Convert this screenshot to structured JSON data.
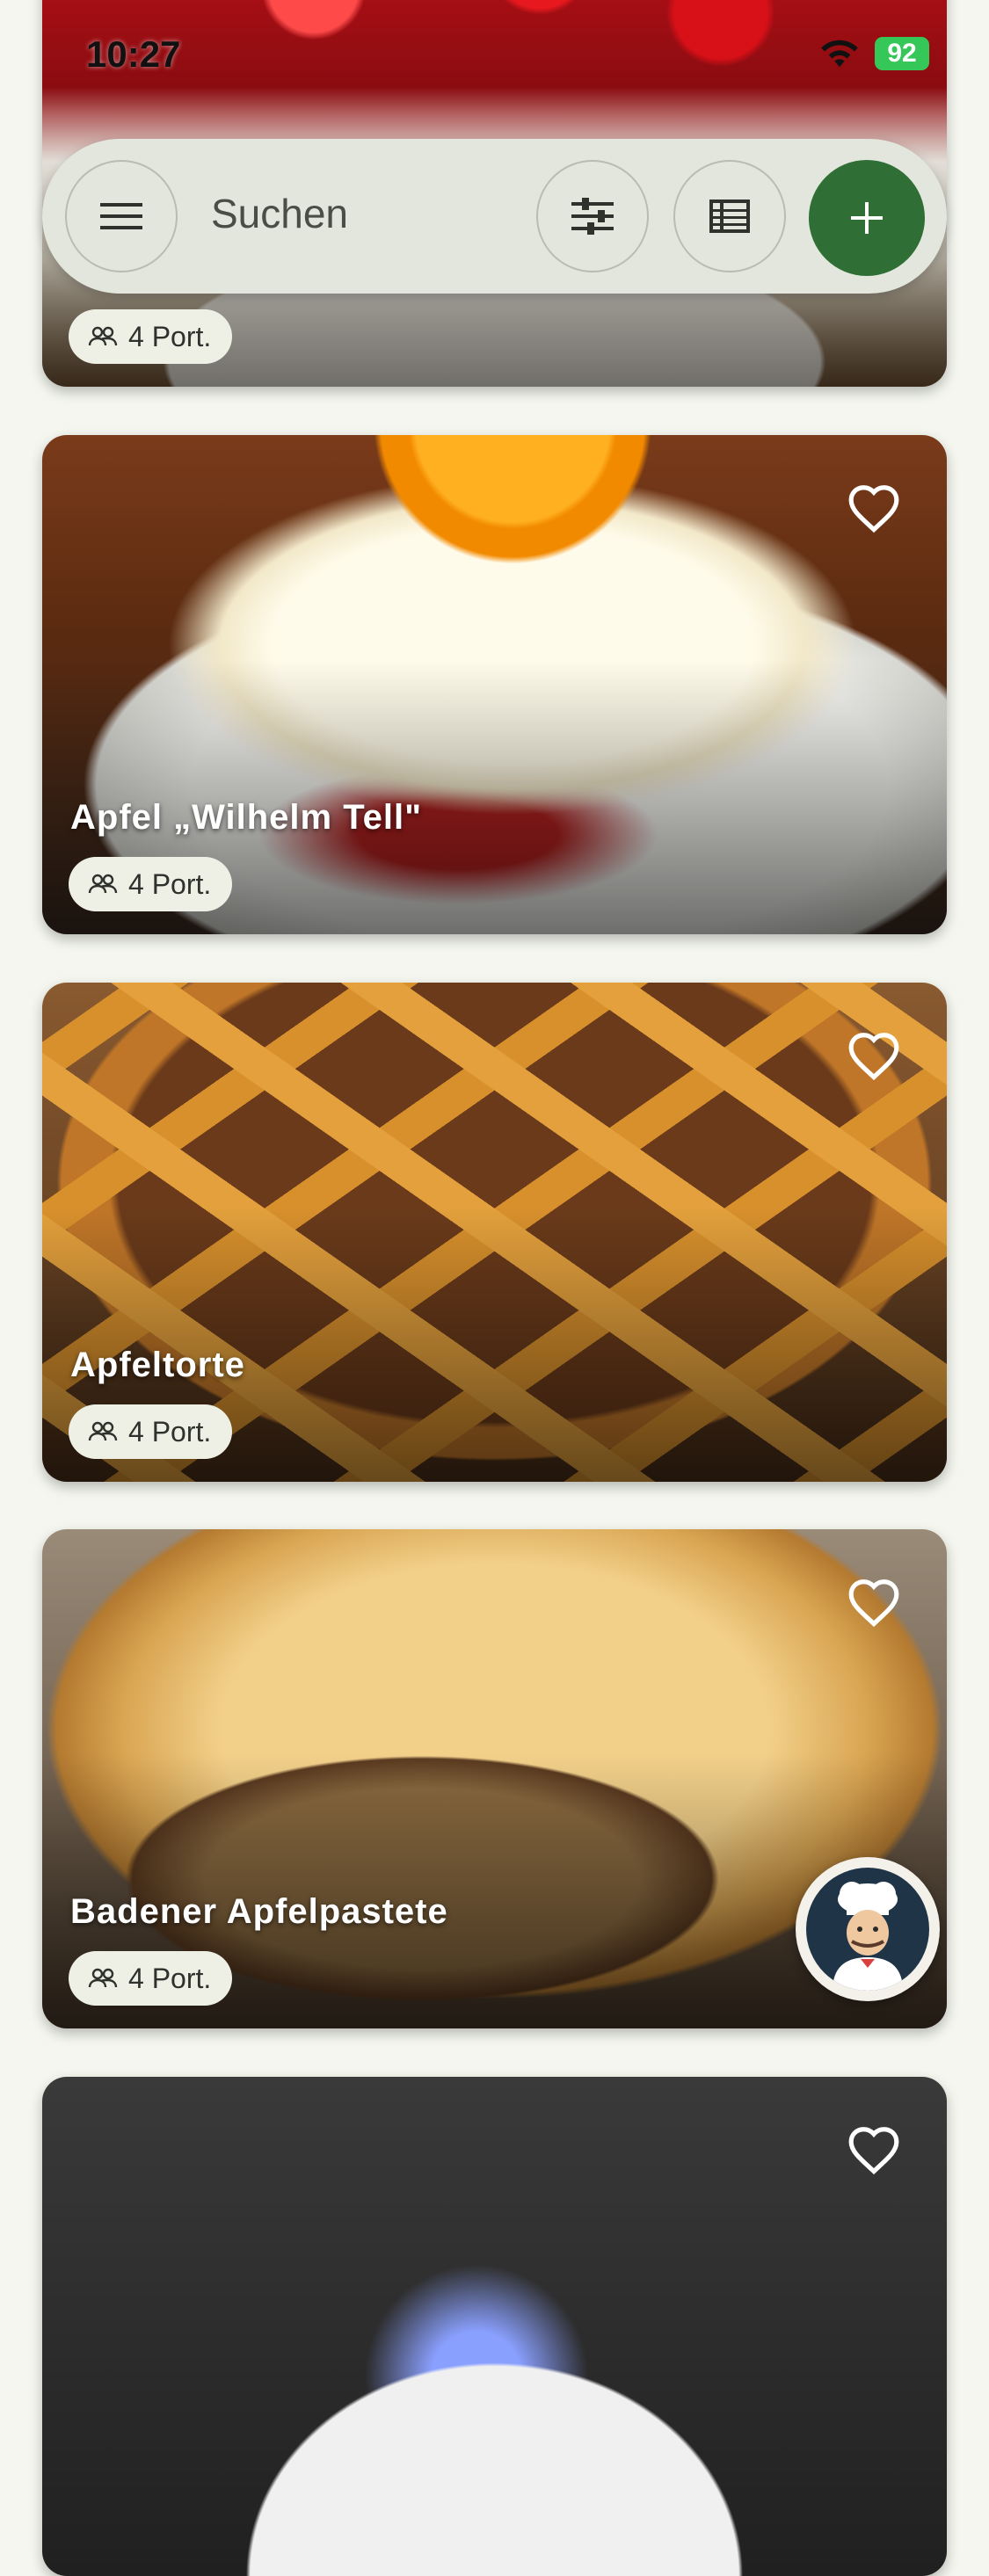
{
  "status_bar": {
    "time": "10:27",
    "battery": "92"
  },
  "search_bar": {
    "placeholder": "Suchen"
  },
  "recipes": [
    {
      "title": "",
      "portions": "4 Port."
    },
    {
      "title": "Apfel „Wilhelm Tell\"",
      "portions": "4 Port."
    },
    {
      "title": "Apfeltorte",
      "portions": "4 Port."
    },
    {
      "title": "Badener Apfelpastete",
      "portions": "4 Port."
    },
    {
      "title": "",
      "portions": ""
    }
  ],
  "colors": {
    "background": "#f4f6ef",
    "accent": "#2f6f35",
    "search_bar": "#e3e6dc",
    "chip": "#eef0e6"
  },
  "icons": [
    "menu-icon",
    "filter-icon",
    "list-view-icon",
    "add-icon",
    "heart-outline-icon",
    "people-icon",
    "chef-avatar-icon"
  ]
}
